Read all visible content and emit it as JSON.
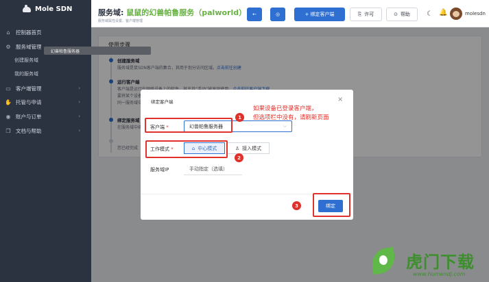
{
  "brand": {
    "name": "Mole SDN"
  },
  "sidebar": {
    "items": [
      {
        "label": "控制器首页",
        "icon": "home-icon",
        "glyph": "⌂",
        "sub": false
      },
      {
        "label": "服务域管理",
        "icon": "network-icon",
        "glyph": "⚙",
        "sub": false,
        "chevron": "⌄"
      },
      {
        "label": "创建服务域",
        "sub": true
      },
      {
        "label": "我的服务域",
        "sub": true
      },
      {
        "label": "客户端管理",
        "icon": "client-icon",
        "glyph": "▭",
        "sub": false,
        "chevron": "›"
      },
      {
        "label": "托管与申请",
        "icon": "hand-icon",
        "glyph": "✋",
        "sub": false,
        "chevron": "›"
      },
      {
        "label": "账户与订单",
        "icon": "account-icon",
        "glyph": "◉",
        "sub": false,
        "chevron": "›"
      },
      {
        "label": "文档与帮助",
        "icon": "doc-icon",
        "glyph": "❐",
        "sub": false,
        "chevron": "›"
      }
    ]
  },
  "header": {
    "title_prefix": "服务域:",
    "title_highlight": "鼠鼠的幻兽帕鲁服务（palworld）",
    "subtitle": "服务域属性设置、客户端管理",
    "back_glyph": "←",
    "settings_glyph": "◎",
    "bind_button": "+ 绑定客户端",
    "license_button": "许可",
    "license_glyph": "⎘",
    "help_button": "帮助",
    "help_glyph": "⊙",
    "moon_glyph": "☾",
    "bell_glyph": "🔔",
    "username": "molesdn"
  },
  "usage": {
    "title": "使用步骤",
    "steps": [
      {
        "title": "创建服务域",
        "desc": "服务域是鼠SDN客户端的集合，其用于划分访问区域。",
        "link": "点击前往创建"
      },
      {
        "title": "运行客户端",
        "desc": "客户端是运行在网络设备上的软件，其支持“手动”被发现使用。",
        "link": "点击前往客户端下载"
      },
      {
        "title": "",
        "desc": "要将某个设备加入服务域，请在设备上安装客户端软件。",
        "link": ""
      },
      {
        "title": "",
        "desc": "同一服务域中的设备可以相互访问。",
        "link": ""
      },
      {
        "title": "绑定服务域",
        "desc": "在服务域中绑定客户端，使其加入服务域。",
        "link": ""
      },
      {
        "title": "",
        "desc": "您已经完成",
        "link": ""
      }
    ]
  },
  "modal": {
    "title": "绑定客户端",
    "close_glyph": "×",
    "client_label": "客户端",
    "required_mark": "*",
    "client_value": "幻兽帕鲁服务器",
    "dropdown_option": "幻兽帕鲁服务器",
    "select_arrow": "⌵",
    "mode_label": "工作模式",
    "mode_options": [
      {
        "label": "中心模式",
        "glyph": "⌂",
        "selected": true
      },
      {
        "label": "接入模式",
        "glyph": "♙",
        "selected": false
      }
    ],
    "ip_label": "服务域IP",
    "ip_value": "手动指定（选填）",
    "confirm_button": "绑定"
  },
  "annotation": {
    "color": "#e0302a",
    "markers": [
      "1",
      "2",
      "3"
    ],
    "note": "如果设备已登录客户端，\n但选项栏中没有，请刷新页面"
  },
  "watermark": {
    "text": "虎门下载",
    "url": "www.humendj.com"
  }
}
